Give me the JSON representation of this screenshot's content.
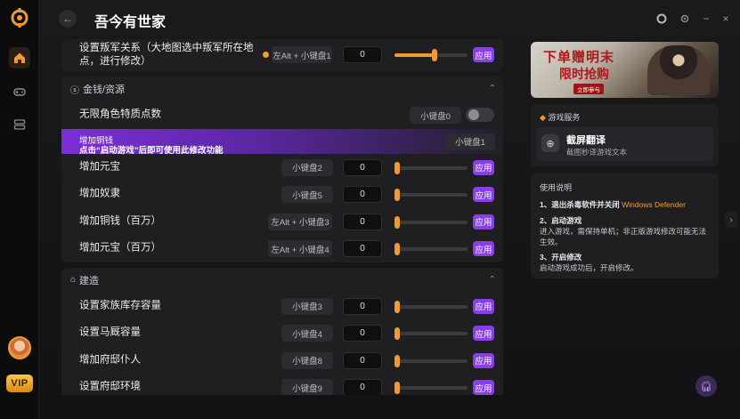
{
  "app": {
    "title": "吾今有世家"
  },
  "rail": {
    "vip_label": "VIP"
  },
  "sections": {
    "top_row": {
      "label": "设置叛军关系（大地图选中叛军所在地点，进行修改）",
      "hotkey": "左Alt + 小键盘1",
      "value": "0",
      "slider_level": 0.55,
      "apply": "应用"
    },
    "money": {
      "title": "金钱/资源",
      "toggle_row": {
        "label": "无限角色特质点数",
        "hotkey": "小键盘0"
      },
      "highlight_row": {
        "label": "增加铜钱",
        "note": "点击“启动游戏”后即可使用此修改功能",
        "hotkey": "小键盘1"
      },
      "rows": [
        {
          "label": "增加元宝",
          "hotkey": "小键盘2",
          "value": "0",
          "apply": "应用"
        },
        {
          "label": "增加奴隶",
          "hotkey": "小键盘5",
          "value": "0",
          "apply": "应用"
        },
        {
          "label": "增加铜钱（百万）",
          "hotkey": "左Alt + 小键盘3",
          "value": "0",
          "apply": "应用"
        },
        {
          "label": "增加元宝（百万）",
          "hotkey": "左Alt + 小键盘4",
          "value": "0",
          "apply": "应用"
        }
      ]
    },
    "build": {
      "title": "建造",
      "rows": [
        {
          "label": "设置家族库存容量",
          "hotkey": "小键盘3",
          "value": "0",
          "apply": "应用"
        },
        {
          "label": "设置马厩容量",
          "hotkey": "小键盘4",
          "value": "0",
          "apply": "应用"
        },
        {
          "label": "增加府邸仆人",
          "hotkey": "小键盘8",
          "value": "0",
          "apply": "应用"
        },
        {
          "label": "设置府邸环境",
          "hotkey": "小键盘9",
          "value": "0",
          "apply": "应用"
        }
      ]
    }
  },
  "banner": {
    "line1": "下单赠明末",
    "line2": "限时抢购",
    "tag": "立即参与"
  },
  "service": {
    "header": "游戏服务",
    "name": "截屏翻译",
    "desc": "截图秒译游戏文本"
  },
  "guide": {
    "header": "使用说明",
    "step1_title": "1、退出杀毒软件并关闭",
    "step1_link": "Windows Defender",
    "step2_title": "2、启动游戏",
    "step2_text": "进入游戏，需保持单机；非正版游戏修改可能无法生效。",
    "step3_title": "3、开启修改",
    "step3_text": "启动游戏成功后，开启修改。"
  },
  "colors": {
    "accent": "#f19a33",
    "apply": "#8a3ee8",
    "highlight": "#7b2fd6"
  }
}
